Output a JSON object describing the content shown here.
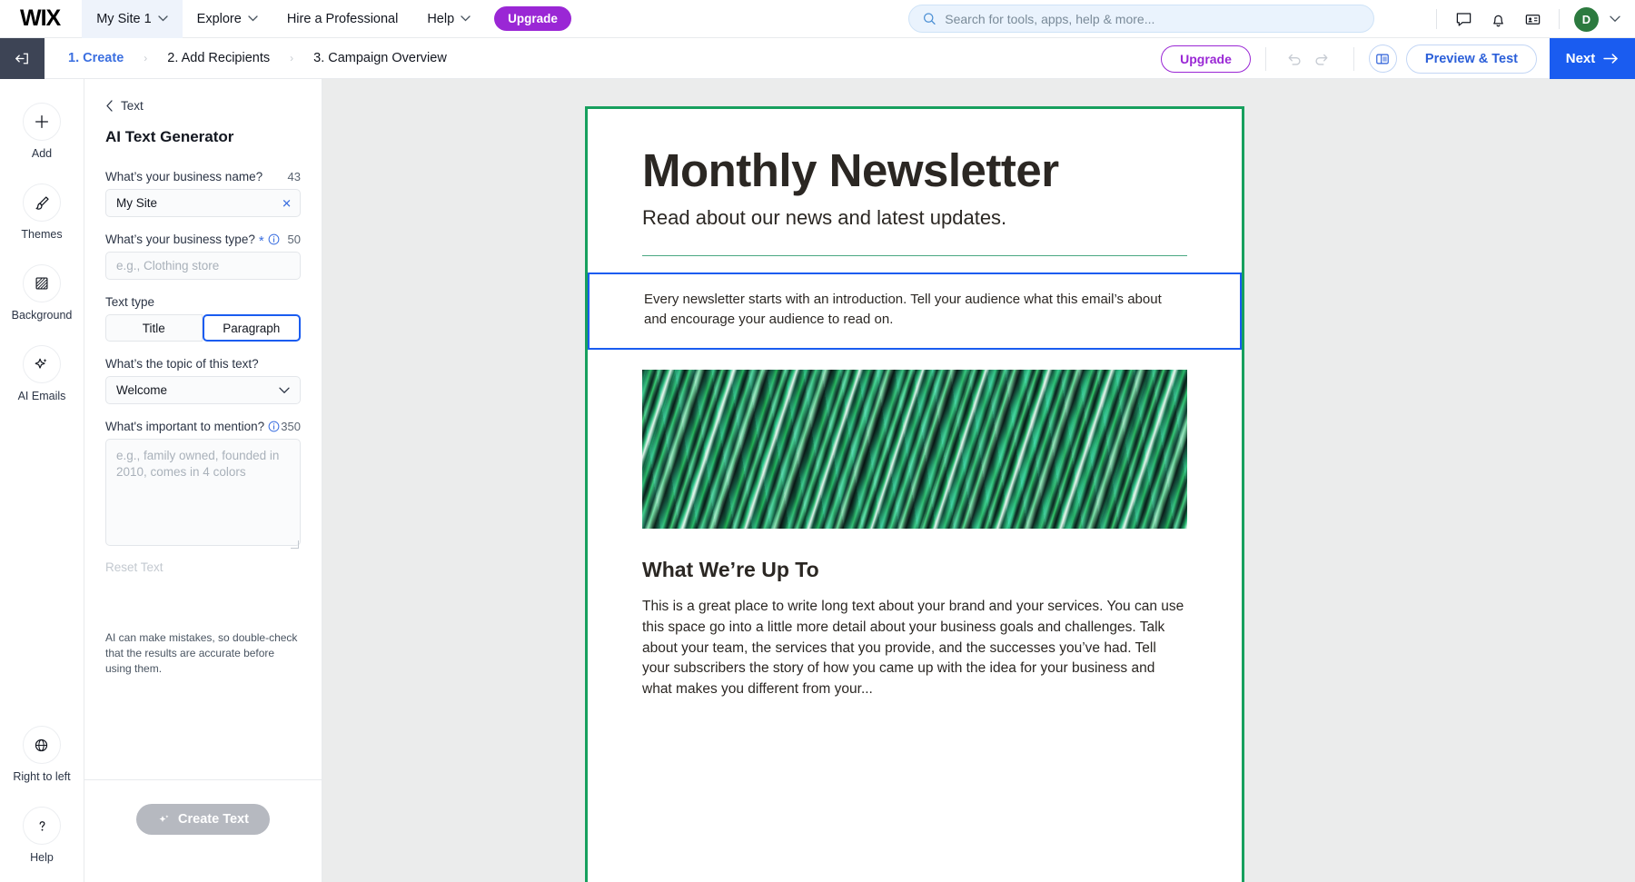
{
  "header": {
    "logo": "WIX",
    "site_name": "My Site 1",
    "nav": [
      {
        "label": "Explore",
        "caret": true
      },
      {
        "label": "Hire a Professional",
        "caret": false
      },
      {
        "label": "Help",
        "caret": true
      }
    ],
    "upgrade_label": "Upgrade",
    "search_placeholder": "Search for tools, apps, help & more...",
    "search_value": "",
    "icons": [
      "chat-icon",
      "bell-icon",
      "contacts-icon"
    ],
    "avatar_initial": "D",
    "avatar_color": "#2c7a3f"
  },
  "stepbar": {
    "back_icon": "exit-icon",
    "steps": [
      {
        "label": "1. Create",
        "active": true
      },
      {
        "label": "2. Add Recipients",
        "active": false
      },
      {
        "label": "3. Campaign Overview",
        "active": false
      }
    ],
    "separator": "›",
    "upgrade_label": "Upgrade",
    "undo_icon": "undo-icon",
    "redo_icon": "redo-icon",
    "layout_icon": "layout-panel-icon",
    "preview_label": "Preview & Test",
    "next_label": "Next",
    "next_arrow": "→",
    "accent_blue": "#1a5cf0",
    "accent_purple": "#9A27D5"
  },
  "rail": {
    "items": [
      {
        "label": "Add",
        "icon": "plus-icon"
      },
      {
        "label": "Themes",
        "icon": "brush-icon"
      },
      {
        "label": "Background",
        "icon": "background-icon"
      },
      {
        "label": "AI Emails",
        "icon": "sparkle-icon"
      }
    ],
    "bottom": [
      {
        "label": "Right to left",
        "icon": "globe-icon"
      },
      {
        "label": "Help",
        "icon": "question-icon"
      }
    ]
  },
  "panel": {
    "back_label": "Text",
    "title": "AI Text Generator",
    "business_name": {
      "label": "What’s your business name?",
      "counter": "43",
      "value": "My Site",
      "clear_icon": "clear-x-icon"
    },
    "business_type": {
      "label": "What’s your business type?",
      "required": "*",
      "info_icon": "info-icon",
      "counter": "50",
      "value": "",
      "placeholder": "e.g., Clothing store"
    },
    "text_type": {
      "label": "Text type",
      "options": [
        "Title",
        "Paragraph"
      ],
      "selected": "Paragraph"
    },
    "topic": {
      "label": "What’s the topic of this text?",
      "value": "Welcome",
      "chevron": "chevron-down-icon"
    },
    "important": {
      "label": "What's important to mention?",
      "info_icon": "info-icon",
      "counter": "350",
      "value": "",
      "placeholder": "e.g., family owned, founded in 2010, comes in 4 colors"
    },
    "reset_label": "Reset Text",
    "disclaimer": "AI can make mistakes, so double-check that the results are accurate before using them.",
    "create_label": "Create Text",
    "create_icon": "sparkle-icon"
  },
  "email": {
    "border_color": "#17a05e",
    "title": "Monthly Newsletter",
    "subtitle": "Read about our news and latest updates.",
    "intro": "Every newsletter starts with an introduction. Tell your audience what this email’s about and encourage your audience to read on.",
    "hero_alt": "green-marbled-abstract-image",
    "section_heading": "What We’re Up To",
    "body": "This is a great place to write long text about your brand and your services. You can use this space go into a little more detail about your business goals and challenges. Talk about your team, the services that you provide, and the successes you’ve had. Tell your subscribers the story of how you came up with the idea for your business and what makes you different from your..."
  },
  "element_toolbar": {
    "buttons": [
      {
        "icon": "arrow-up-icon",
        "name": "move-up-button"
      },
      {
        "icon": "arrow-down-icon",
        "name": "move-down-button"
      },
      {
        "icon": "duplicate-icon",
        "name": "duplicate-button"
      },
      {
        "icon": "trash-icon",
        "name": "delete-button"
      }
    ]
  }
}
